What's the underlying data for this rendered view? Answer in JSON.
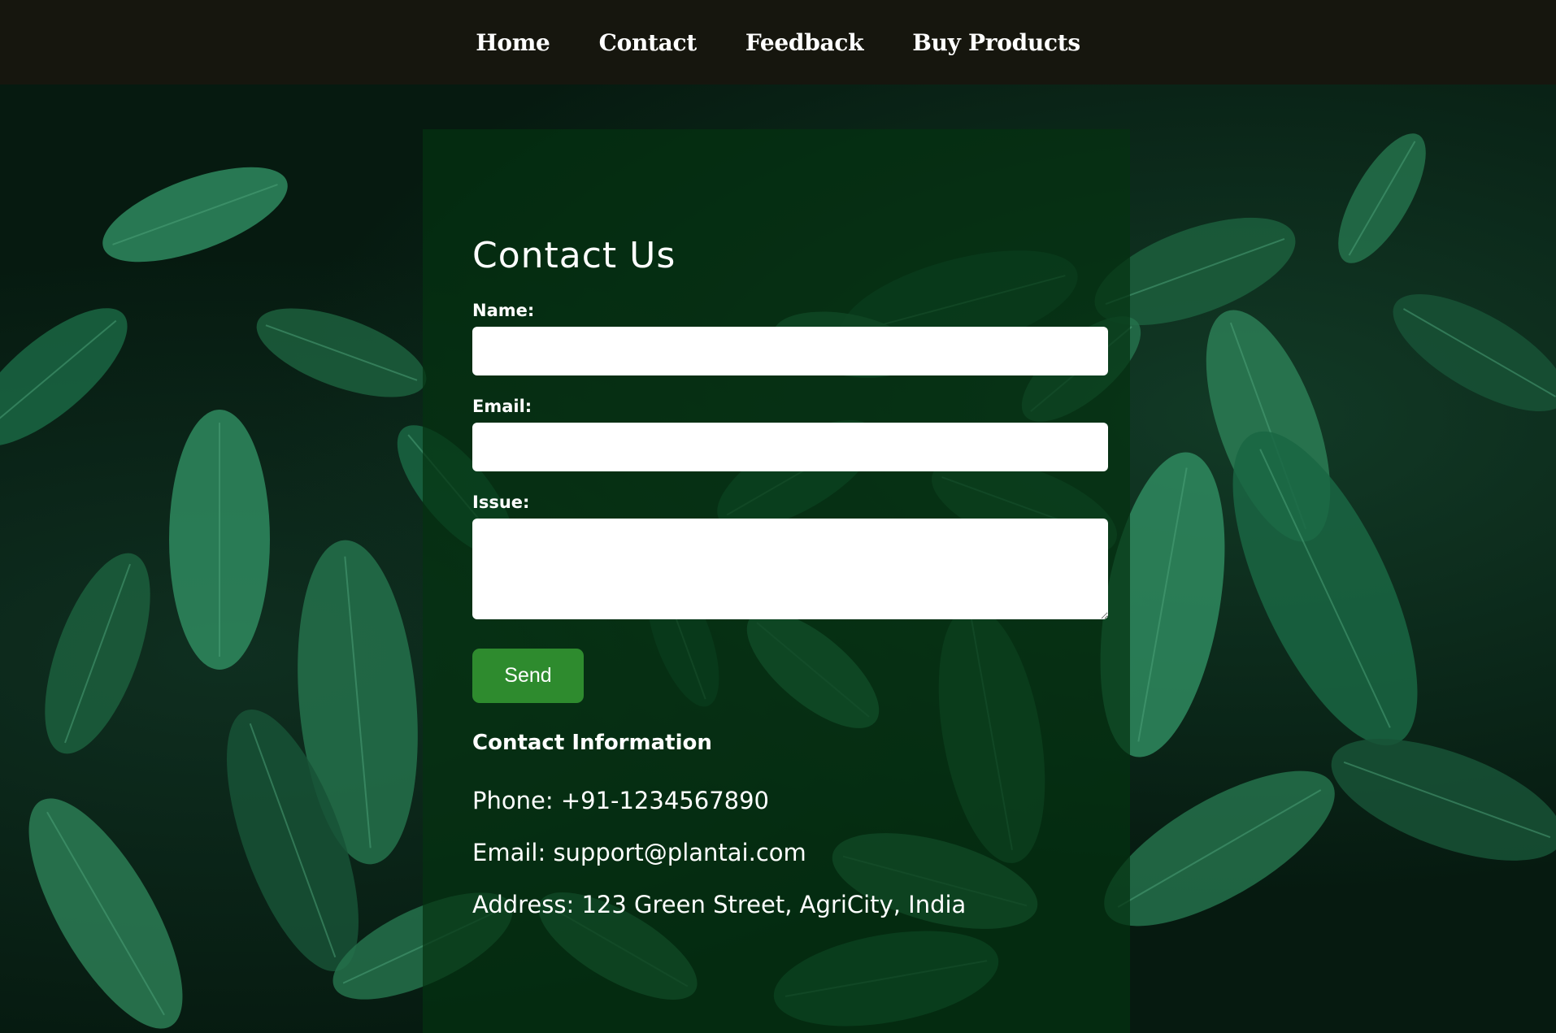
{
  "nav": {
    "items": [
      {
        "label": "Home"
      },
      {
        "label": "Contact"
      },
      {
        "label": "Feedback"
      },
      {
        "label": "Buy Products"
      }
    ]
  },
  "contact_form": {
    "title": "Contact Us",
    "name_label": "Name:",
    "name_value": "",
    "email_label": "Email:",
    "email_value": "",
    "issue_label": "Issue:",
    "issue_value": "",
    "send_label": "Send"
  },
  "contact_info": {
    "heading": "Contact Information",
    "phone": "Phone: +91-1234567890",
    "email": "Email: support@plantai.com",
    "address": "Address: 123 Green Street, AgriCity, India"
  },
  "colors": {
    "nav_bg": "#16160e",
    "panel_bg": "#043210",
    "button": "#2e8b2e",
    "leaf": "#1f6b45"
  }
}
